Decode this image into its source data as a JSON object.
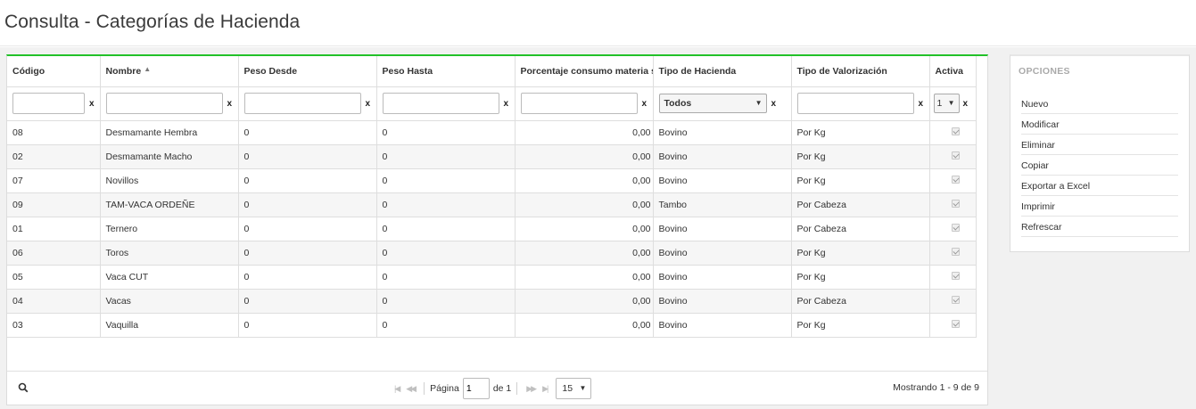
{
  "page": {
    "title": "Consulta - Categorías de Hacienda"
  },
  "columns": [
    {
      "label": "Código",
      "sorted": ""
    },
    {
      "label": "Nombre",
      "sorted": "asc"
    },
    {
      "label": "Peso Desde",
      "sorted": ""
    },
    {
      "label": "Peso Hasta",
      "sorted": ""
    },
    {
      "label": "Porcentaje consumo materia seca",
      "sorted": ""
    },
    {
      "label": "Tipo de Hacienda",
      "sorted": ""
    },
    {
      "label": "Tipo de Valorización",
      "sorted": ""
    },
    {
      "label": "Activa",
      "sorted": ""
    }
  ],
  "filters": {
    "codigo": "",
    "nombre": "",
    "peso_desde": "",
    "peso_hasta": "",
    "porcentaje": "",
    "tipo_hacienda": "Todos",
    "tipo_valorizacion": "",
    "activa": "1",
    "clear_label": "x"
  },
  "rows": [
    {
      "codigo": "08",
      "nombre": "Desmamante Hembra",
      "peso_desde": "0",
      "peso_hasta": "0",
      "porcentaje": "0,00",
      "tipo_hacienda": "Bovino",
      "tipo_valorizacion": "Por Kg",
      "activa": true
    },
    {
      "codigo": "02",
      "nombre": "Desmamante Macho",
      "peso_desde": "0",
      "peso_hasta": "0",
      "porcentaje": "0,00",
      "tipo_hacienda": "Bovino",
      "tipo_valorizacion": "Por Kg",
      "activa": true
    },
    {
      "codigo": "07",
      "nombre": "Novillos",
      "peso_desde": "0",
      "peso_hasta": "0",
      "porcentaje": "0,00",
      "tipo_hacienda": "Bovino",
      "tipo_valorizacion": "Por Kg",
      "activa": true
    },
    {
      "codigo": "09",
      "nombre": "TAM-VACA ORDEÑE",
      "peso_desde": "0",
      "peso_hasta": "0",
      "porcentaje": "0,00",
      "tipo_hacienda": "Tambo",
      "tipo_valorizacion": "Por Cabeza",
      "activa": true
    },
    {
      "codigo": "01",
      "nombre": "Ternero",
      "peso_desde": "0",
      "peso_hasta": "0",
      "porcentaje": "0,00",
      "tipo_hacienda": "Bovino",
      "tipo_valorizacion": "Por Cabeza",
      "activa": true
    },
    {
      "codigo": "06",
      "nombre": "Toros",
      "peso_desde": "0",
      "peso_hasta": "0",
      "porcentaje": "0,00",
      "tipo_hacienda": "Bovino",
      "tipo_valorizacion": "Por Kg",
      "activa": true
    },
    {
      "codigo": "05",
      "nombre": "Vaca CUT",
      "peso_desde": "0",
      "peso_hasta": "0",
      "porcentaje": "0,00",
      "tipo_hacienda": "Bovino",
      "tipo_valorizacion": "Por Kg",
      "activa": true
    },
    {
      "codigo": "04",
      "nombre": "Vacas",
      "peso_desde": "0",
      "peso_hasta": "0",
      "porcentaje": "0,00",
      "tipo_hacienda": "Bovino",
      "tipo_valorizacion": "Por Cabeza",
      "activa": true
    },
    {
      "codigo": "03",
      "nombre": "Vaquilla",
      "peso_desde": "0",
      "peso_hasta": "0",
      "porcentaje": "0,00",
      "tipo_hacienda": "Bovino",
      "tipo_valorizacion": "Por Kg",
      "activa": true
    }
  ],
  "pager": {
    "page_label": "Página",
    "current_page": "1",
    "of_label": "de 1",
    "page_size": "15",
    "summary": "Mostrando 1 - 9 de 9"
  },
  "options": {
    "title": "OPCIONES",
    "items": [
      "Nuevo",
      "Modificar",
      "Eliminar",
      "Copiar",
      "Exportar a Excel",
      "Imprimir",
      "Refrescar"
    ]
  },
  "colors": {
    "accent": "#22c129",
    "border": "#dedede",
    "background": "#f1f1f1"
  }
}
